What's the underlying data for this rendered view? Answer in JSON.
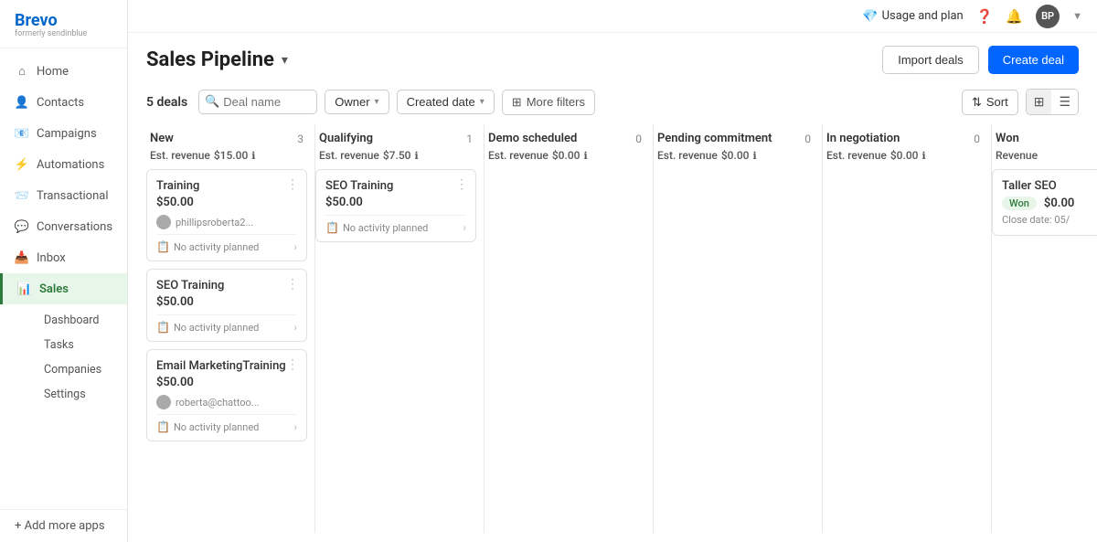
{
  "app": {
    "logo": "Brevo",
    "logo_sub": "formerly sendinblue",
    "avatar_initials": "BP"
  },
  "topbar": {
    "usage_label": "Usage and plan",
    "help_icon": "❓",
    "bell_icon": "🔔"
  },
  "sidebar": {
    "items": [
      {
        "id": "home",
        "label": "Home",
        "icon": "⌂"
      },
      {
        "id": "contacts",
        "label": "Contacts",
        "icon": "👤"
      },
      {
        "id": "campaigns",
        "label": "Campaigns",
        "icon": "📧"
      },
      {
        "id": "automations",
        "label": "Automations",
        "icon": "⚡"
      },
      {
        "id": "transactional",
        "label": "Transactional",
        "icon": "📨"
      },
      {
        "id": "conversations",
        "label": "Conversations",
        "icon": "💬"
      },
      {
        "id": "inbox",
        "label": "Inbox",
        "icon": "📥"
      },
      {
        "id": "sales",
        "label": "Sales",
        "icon": "📊",
        "active": true
      }
    ],
    "sales_sub": [
      {
        "label": "Dashboard"
      },
      {
        "label": "Tasks"
      },
      {
        "label": "Companies"
      },
      {
        "label": "Settings"
      }
    ],
    "add_more": "+ Add more apps"
  },
  "page": {
    "title": "Sales Pipeline",
    "btn_import": "Import deals",
    "btn_create": "Create deal"
  },
  "filters": {
    "deals_count": "5 deals",
    "search_placeholder": "Deal name",
    "owner_label": "Owner",
    "created_date_label": "Created date",
    "more_filters_label": "More filters",
    "sort_label": "Sort"
  },
  "columns": [
    {
      "id": "new",
      "title": "New",
      "count": 3,
      "revenue_label": "Est. revenue",
      "revenue_value": "$15.00",
      "cards": [
        {
          "title": "Training",
          "value": "$50.00",
          "owner": "phillipsroberta2...",
          "activity": "No activity planned"
        },
        {
          "title": "SEO Training",
          "value": "$50.00",
          "owner": null,
          "activity": "No activity planned"
        },
        {
          "title": "Email MarketingTraining",
          "value": "$50.00",
          "owner": "roberta@chattoo...",
          "activity": "No activity planned"
        }
      ]
    },
    {
      "id": "qualifying",
      "title": "Qualifying",
      "count": 1,
      "revenue_label": "Est. revenue",
      "revenue_value": "$7.50",
      "cards": [
        {
          "title": "SEO Training",
          "value": "$50.00",
          "owner": null,
          "activity": "No activity planned"
        }
      ]
    },
    {
      "id": "demo_scheduled",
      "title": "Demo scheduled",
      "count": 0,
      "revenue_label": "Est. revenue",
      "revenue_value": "$0.00",
      "cards": []
    },
    {
      "id": "pending_commitment",
      "title": "Pending commitment",
      "count": 0,
      "revenue_label": "Est. revenue",
      "revenue_value": "$0.00",
      "cards": []
    },
    {
      "id": "in_negotiation",
      "title": "In negotiation",
      "count": 0,
      "revenue_label": "Est. revenue",
      "revenue_value": "$0.00",
      "cards": []
    },
    {
      "id": "won",
      "title": "Won",
      "count": null,
      "revenue_label": "Revenue",
      "revenue_value": null,
      "cards": [
        {
          "title": "Taller SEO",
          "value": "$0.00",
          "won_badge": "Won",
          "close_date": "Close date: 05/"
        }
      ]
    }
  ]
}
